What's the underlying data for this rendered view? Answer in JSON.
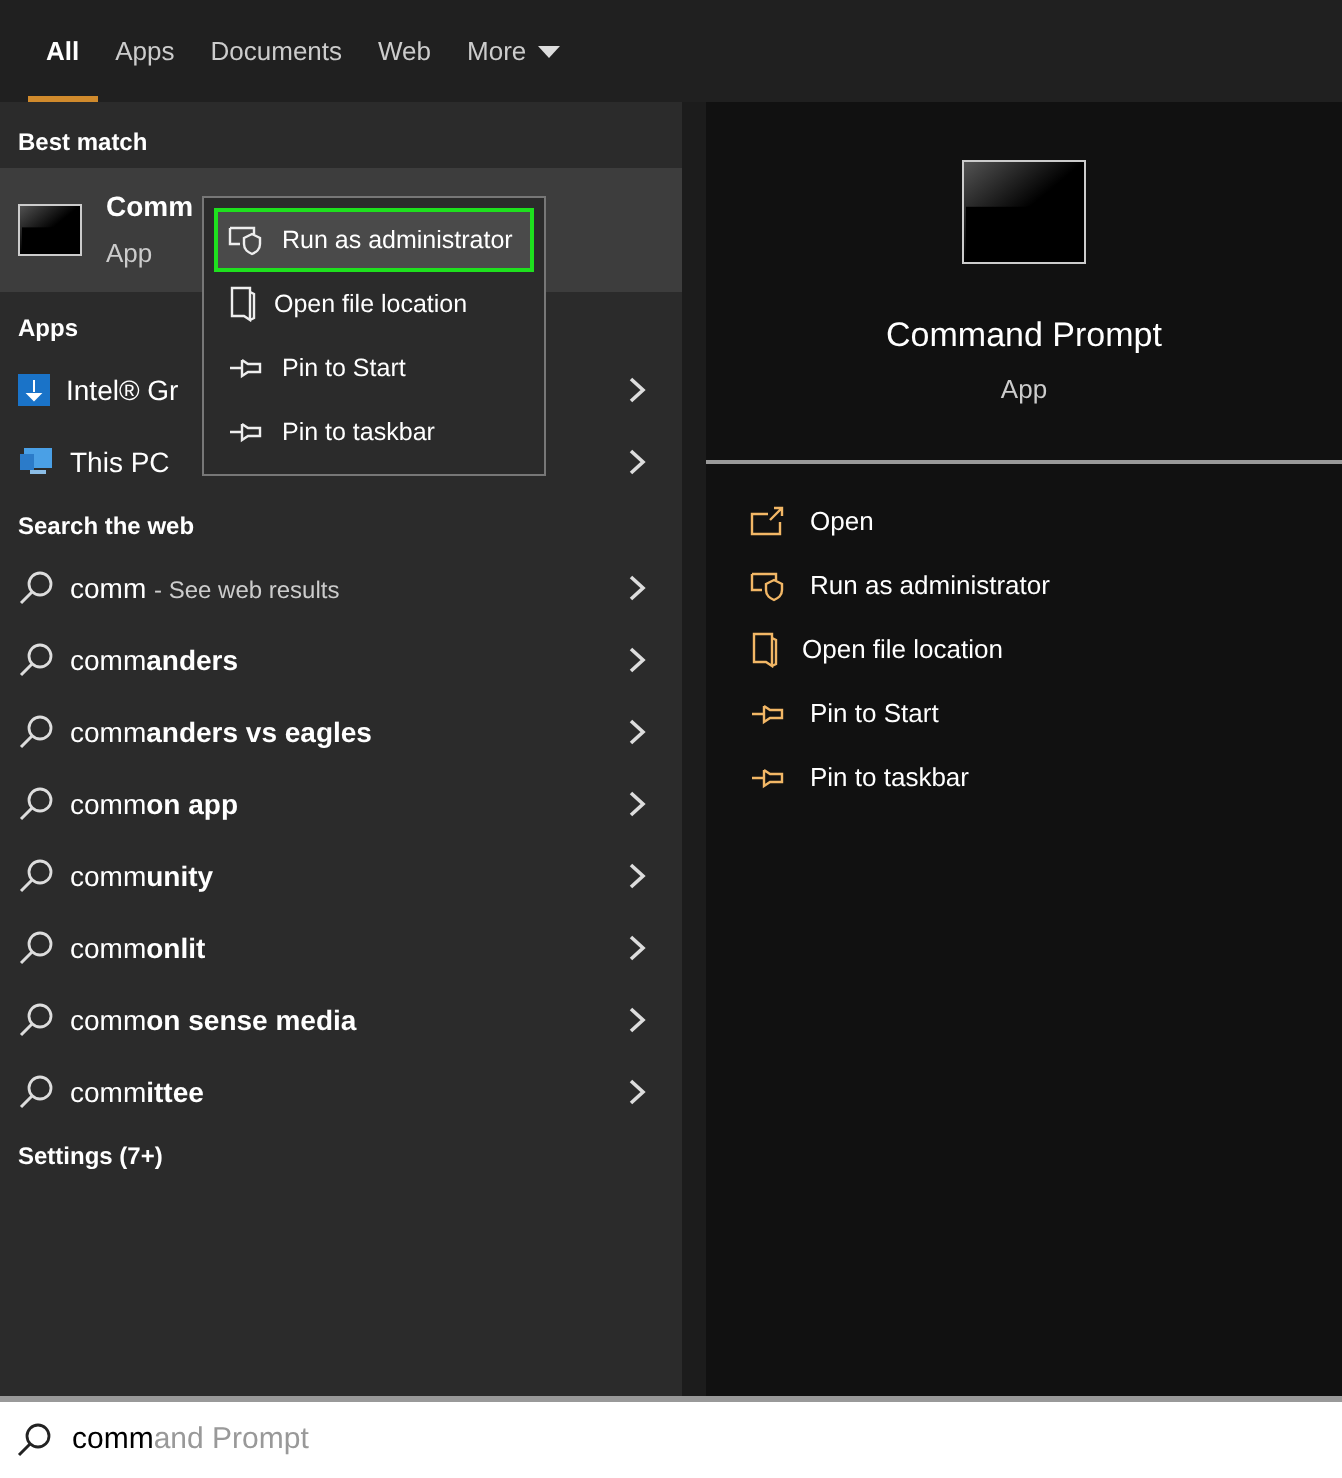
{
  "tabs": [
    {
      "label": "All",
      "selected": true
    },
    {
      "label": "Apps",
      "selected": false
    },
    {
      "label": "Documents",
      "selected": false
    },
    {
      "label": "Web",
      "selected": false
    },
    {
      "label": "More",
      "selected": false,
      "dropdown": true
    }
  ],
  "best_match": {
    "heading": "Best match",
    "title": "Comm",
    "subtitle": "App"
  },
  "context_menu": [
    {
      "kind": "admin",
      "label": "Run as administrator",
      "selected": true
    },
    {
      "kind": "folder",
      "label": "Open file location",
      "selected": false
    },
    {
      "kind": "pin",
      "label": "Pin to Start",
      "selected": false
    },
    {
      "kind": "pin",
      "label": "Pin to taskbar",
      "selected": false
    }
  ],
  "apps": {
    "heading": "Apps",
    "items": [
      {
        "kind": "intel",
        "label": "Intel® Gr"
      },
      {
        "kind": "pc",
        "label": "This PC"
      }
    ]
  },
  "web": {
    "heading": "Search the web",
    "items": [
      {
        "label": "comm",
        "suffix": "- See web results"
      },
      {
        "label": "comm**anders**"
      },
      {
        "label": "comm**anders vs eagles**"
      },
      {
        "label": "comm**on app**"
      },
      {
        "label": "comm**unity**"
      },
      {
        "label": "comm**onlit**"
      },
      {
        "label": "comm**on sense media**"
      },
      {
        "label": "comm**ittee**"
      }
    ]
  },
  "settings_heading": "Settings (7+)",
  "preview": {
    "title": "Command Prompt",
    "subtitle": "App",
    "actions": [
      {
        "kind": "open",
        "label": "Open"
      },
      {
        "kind": "admin",
        "label": "Run as administrator"
      },
      {
        "kind": "folder",
        "label": "Open file location"
      },
      {
        "kind": "pin",
        "label": "Pin to Start"
      },
      {
        "kind": "pin",
        "label": "Pin to taskbar"
      }
    ]
  },
  "search": {
    "value": "comm",
    "completion": "and Prompt"
  }
}
